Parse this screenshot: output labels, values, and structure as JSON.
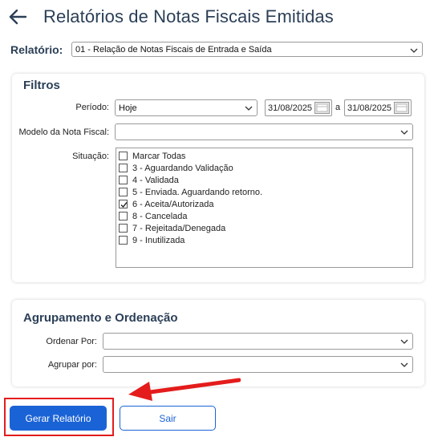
{
  "header": {
    "title": "Relatórios de Notas Fiscais Emitidas"
  },
  "report": {
    "label": "Relatório:",
    "value": "01 - Relação de Notas Fiscais de Entrada e Saída"
  },
  "filters": {
    "title": "Filtros",
    "period_label": "Período:",
    "period_value": "Hoje",
    "date_from": "31/08/2025",
    "date_sep": "a",
    "date_to": "31/08/2025",
    "model_label": "Modelo da Nota Fiscal:",
    "model_value": "",
    "status_label": "Situação:",
    "status_items": [
      {
        "label": "Marcar Todas",
        "checked": false
      },
      {
        "label": "3 - Aguardando Validação",
        "checked": false
      },
      {
        "label": "4 - Validada",
        "checked": false
      },
      {
        "label": "5 - Enviada. Aguardando retorno.",
        "checked": false
      },
      {
        "label": "6 - Aceita/Autorizada",
        "checked": true
      },
      {
        "label": "8 - Cancelada",
        "checked": false
      },
      {
        "label": "7 - Rejeitada/Denegada",
        "checked": false
      },
      {
        "label": "9 - Inutilizada",
        "checked": false
      }
    ]
  },
  "grouping": {
    "title": "Agrupamento e Ordenação",
    "order_label": "Ordenar Por:",
    "order_value": "",
    "group_label": "Agrupar por:",
    "group_value": ""
  },
  "actions": {
    "generate_label": "Gerar Relatório",
    "exit_label": "Sair"
  },
  "colors": {
    "title": "#2b3f57",
    "primary": "#1a63d6",
    "annotation": "#e41c1c"
  }
}
